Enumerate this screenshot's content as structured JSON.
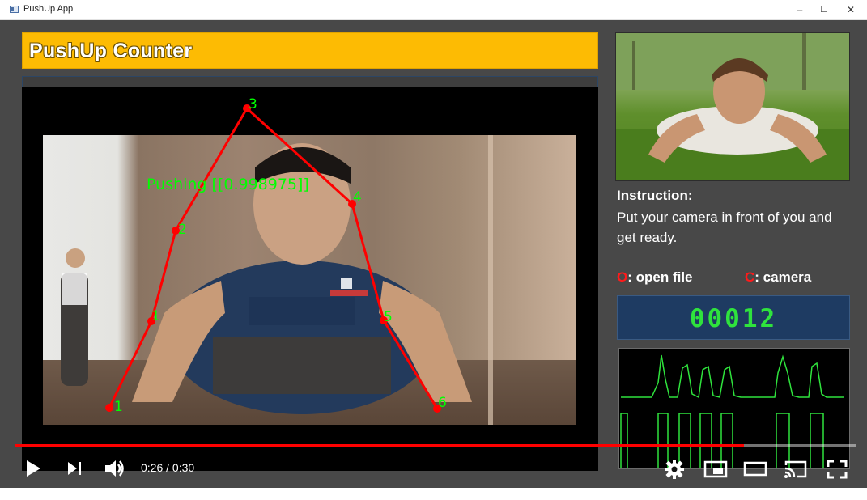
{
  "window": {
    "title": "PushUp App",
    "controls": {
      "minimize": "–",
      "maximize": "☐",
      "close": "✕"
    }
  },
  "app": {
    "banner": "PushUp Counter",
    "pose": {
      "label": "Pushing [[0.998975]]",
      "keypoints": [
        "1",
        "2",
        "3",
        "4",
        "5",
        "6"
      ]
    },
    "instruction_title": "Instruction:",
    "instruction_text": "Put your camera in front of you and get ready.",
    "hint_open": {
      "key": "O",
      "text": ": open file"
    },
    "hint_camera": {
      "key": "C",
      "text": ": camera"
    },
    "counter": "00012"
  },
  "player": {
    "time_current": "0:26",
    "time_separator": " / ",
    "time_total": "0:30",
    "progress": 0.8667,
    "icons": [
      "play-icon",
      "next-icon",
      "volume-icon",
      "settings-icon",
      "miniplayer-icon",
      "theater-icon",
      "cast-icon",
      "fullscreen-icon"
    ]
  },
  "colors": {
    "banner": "#fdbb03",
    "keypoint_label": "#00ff00",
    "skeleton": "#ff0000",
    "counter_text": "#2fe33d",
    "counter_bg": "#1e3b62",
    "progress": "#ff0000",
    "key_highlight": "#ff1a1a"
  }
}
